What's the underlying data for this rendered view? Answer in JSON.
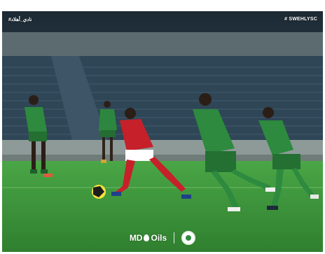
{
  "header": {
    "left_tag": "#نادي_أهلاد",
    "right_tag": "# SWEHLYSC"
  },
  "sponsor": {
    "brand_prefix": "MD",
    "brand_suffix": "Oils",
    "crest_icon": "club-crest-icon"
  },
  "photo": {
    "subject": "football match action",
    "colors": {
      "home_kit": "#2d8a3e",
      "away_kit": "#c6202a",
      "pitch": "#3f9a3c",
      "stands": "#3a4d5c"
    }
  }
}
